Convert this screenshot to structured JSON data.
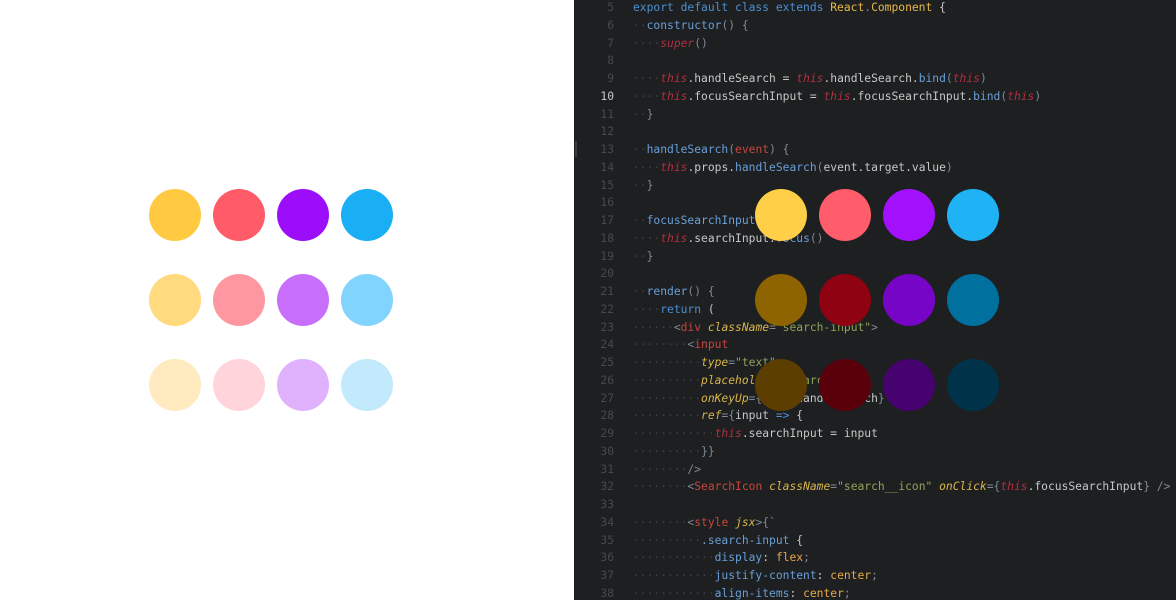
{
  "left_palette": {
    "rows": [
      [
        "#ffc942",
        "#ff5b69",
        "#9c0ef9",
        "#1aaff5"
      ],
      [
        "#ffda7e",
        "#ff97a1",
        "#c76ffb",
        "#80d4fd"
      ],
      [
        "#ffebbf",
        "#ffd4da",
        "#e0b1fd",
        "#c3e9fc"
      ]
    ]
  },
  "right_palette": {
    "rows": [
      [
        "#ffcf48",
        "#ff5d6b",
        "#a310fb",
        "#1fb3f6"
      ],
      [
        "#8d6400",
        "#8e0212",
        "#7605c7",
        "#00719f"
      ],
      [
        "#5c3f00",
        "#59000b",
        "#46036f",
        "#003349"
      ]
    ]
  },
  "editor": {
    "active_line": "10",
    "lines": [
      {
        "n": "5",
        "segs": [
          [
            "kw",
            "export default class extends "
          ],
          [
            "cls",
            "React"
          ],
          [
            "punc",
            "."
          ],
          [
            "cls",
            "Component"
          ],
          [
            "plain",
            " {"
          ]
        ]
      },
      {
        "n": "6",
        "segs": [
          [
            "ws",
            "··"
          ],
          [
            "fn",
            "constructor"
          ],
          [
            "punc",
            "() {"
          ]
        ]
      },
      {
        "n": "7",
        "segs": [
          [
            "ws",
            "····"
          ],
          [
            "this",
            "super"
          ],
          [
            "punc",
            "()"
          ]
        ]
      },
      {
        "n": "8",
        "segs": []
      },
      {
        "n": "9",
        "segs": [
          [
            "ws",
            "····"
          ],
          [
            "this",
            "this"
          ],
          [
            "plain",
            ".handleSearch = "
          ],
          [
            "this",
            "this"
          ],
          [
            "plain",
            ".handleSearch."
          ],
          [
            "fn",
            "bind"
          ],
          [
            "punc",
            "("
          ],
          [
            "this",
            "this"
          ],
          [
            "punc",
            ")"
          ]
        ]
      },
      {
        "n": "10",
        "segs": [
          [
            "ws",
            "····"
          ],
          [
            "this",
            "this"
          ],
          [
            "plain",
            ".focusSearchInput = "
          ],
          [
            "this",
            "this"
          ],
          [
            "plain",
            ".focusSearchInput."
          ],
          [
            "fn",
            "bind"
          ],
          [
            "punc",
            "("
          ],
          [
            "this",
            "this"
          ],
          [
            "punc",
            ")"
          ]
        ]
      },
      {
        "n": "11",
        "segs": [
          [
            "ws",
            "··"
          ],
          [
            "punc",
            "}"
          ]
        ]
      },
      {
        "n": "12",
        "segs": []
      },
      {
        "n": "13",
        "segs": [
          [
            "ws",
            "··"
          ],
          [
            "fn",
            "handleSearch"
          ],
          [
            "punc",
            "("
          ],
          [
            "tag",
            "event"
          ],
          [
            "punc",
            ") {"
          ]
        ]
      },
      {
        "n": "14",
        "segs": [
          [
            "ws",
            "····"
          ],
          [
            "this",
            "this"
          ],
          [
            "plain",
            ".props."
          ],
          [
            "fn",
            "handleSearch"
          ],
          [
            "punc",
            "("
          ],
          [
            "plain",
            "event.target.value"
          ],
          [
            "punc",
            ")"
          ]
        ]
      },
      {
        "n": "15",
        "segs": [
          [
            "ws",
            "··"
          ],
          [
            "punc",
            "}"
          ]
        ]
      },
      {
        "n": "16",
        "segs": []
      },
      {
        "n": "17",
        "segs": [
          [
            "ws",
            "··"
          ],
          [
            "fn",
            "focusSearchInput"
          ],
          [
            "punc",
            "() {"
          ]
        ]
      },
      {
        "n": "18",
        "segs": [
          [
            "ws",
            "····"
          ],
          [
            "this",
            "this"
          ],
          [
            "plain",
            ".searchInput."
          ],
          [
            "fn",
            "focus"
          ],
          [
            "punc",
            "()"
          ]
        ]
      },
      {
        "n": "19",
        "segs": [
          [
            "ws",
            "··"
          ],
          [
            "punc",
            "}"
          ]
        ]
      },
      {
        "n": "20",
        "segs": []
      },
      {
        "n": "21",
        "segs": [
          [
            "ws",
            "··"
          ],
          [
            "fn",
            "render"
          ],
          [
            "punc",
            "() {"
          ]
        ]
      },
      {
        "n": "22",
        "segs": [
          [
            "ws",
            "····"
          ],
          [
            "kw",
            "return"
          ],
          [
            "plain",
            " ("
          ]
        ]
      },
      {
        "n": "23",
        "segs": [
          [
            "ws",
            "······"
          ],
          [
            "punc",
            "<"
          ],
          [
            "tag",
            "div"
          ],
          [
            "plain",
            " "
          ],
          [
            "attr",
            "className"
          ],
          [
            "punc",
            "="
          ],
          [
            "str",
            "\"search-input\""
          ],
          [
            "punc",
            ">"
          ]
        ]
      },
      {
        "n": "24",
        "segs": [
          [
            "ws",
            "········"
          ],
          [
            "punc",
            "<"
          ],
          [
            "tag",
            "input"
          ]
        ]
      },
      {
        "n": "25",
        "segs": [
          [
            "ws",
            "··········"
          ],
          [
            "attr",
            "type"
          ],
          [
            "punc",
            "="
          ],
          [
            "str",
            "\"text\""
          ]
        ]
      },
      {
        "n": "26",
        "segs": [
          [
            "ws",
            "··········"
          ],
          [
            "attr",
            "placeholder"
          ],
          [
            "punc",
            "="
          ],
          [
            "str",
            "\"Search\""
          ]
        ]
      },
      {
        "n": "27",
        "segs": [
          [
            "ws",
            "··········"
          ],
          [
            "attr",
            "onKeyUp"
          ],
          [
            "punc",
            "={"
          ],
          [
            "this",
            "this"
          ],
          [
            "plain",
            ".handleSearch"
          ],
          [
            "punc",
            "}"
          ]
        ]
      },
      {
        "n": "28",
        "segs": [
          [
            "ws",
            "··········"
          ],
          [
            "attr",
            "ref"
          ],
          [
            "punc",
            "={"
          ],
          [
            "plain",
            "input "
          ],
          [
            "kw",
            "=>"
          ],
          [
            "plain",
            " {"
          ]
        ]
      },
      {
        "n": "29",
        "segs": [
          [
            "ws",
            "············"
          ],
          [
            "this",
            "this"
          ],
          [
            "plain",
            ".searchInput = input"
          ]
        ]
      },
      {
        "n": "30",
        "segs": [
          [
            "ws",
            "··········"
          ],
          [
            "punc",
            "}}"
          ]
        ]
      },
      {
        "n": "31",
        "segs": [
          [
            "ws",
            "········"
          ],
          [
            "punc",
            "/>"
          ]
        ]
      },
      {
        "n": "32",
        "segs": [
          [
            "ws",
            "········"
          ],
          [
            "punc",
            "<"
          ],
          [
            "tag",
            "SearchIcon"
          ],
          [
            "plain",
            " "
          ],
          [
            "attr",
            "className"
          ],
          [
            "punc",
            "="
          ],
          [
            "str",
            "\"search__icon\""
          ],
          [
            "plain",
            " "
          ],
          [
            "attr",
            "onClick"
          ],
          [
            "punc",
            "={"
          ],
          [
            "this",
            "this"
          ],
          [
            "plain",
            ".focusSearchInput"
          ],
          [
            "punc",
            "} />"
          ]
        ]
      },
      {
        "n": "33",
        "segs": []
      },
      {
        "n": "34",
        "segs": [
          [
            "ws",
            "········"
          ],
          [
            "punc",
            "<"
          ],
          [
            "tag",
            "style"
          ],
          [
            "plain",
            " "
          ],
          [
            "attr",
            "jsx"
          ],
          [
            "punc",
            ">{`"
          ]
        ]
      },
      {
        "n": "35",
        "segs": [
          [
            "ws",
            "··········"
          ],
          [
            "prop",
            ".search-input"
          ],
          [
            "plain",
            " {"
          ]
        ]
      },
      {
        "n": "36",
        "segs": [
          [
            "ws",
            "············"
          ],
          [
            "prop",
            "display"
          ],
          [
            "plain",
            ": "
          ],
          [
            "val",
            "flex"
          ],
          [
            "punc",
            ";"
          ]
        ]
      },
      {
        "n": "37",
        "segs": [
          [
            "ws",
            "············"
          ],
          [
            "prop",
            "justify-content"
          ],
          [
            "plain",
            ": "
          ],
          [
            "val",
            "center"
          ],
          [
            "punc",
            ";"
          ]
        ]
      },
      {
        "n": "38",
        "segs": [
          [
            "ws",
            "············"
          ],
          [
            "prop",
            "align-items"
          ],
          [
            "plain",
            ": "
          ],
          [
            "val",
            "center"
          ],
          [
            "punc",
            ";"
          ]
        ]
      }
    ]
  }
}
